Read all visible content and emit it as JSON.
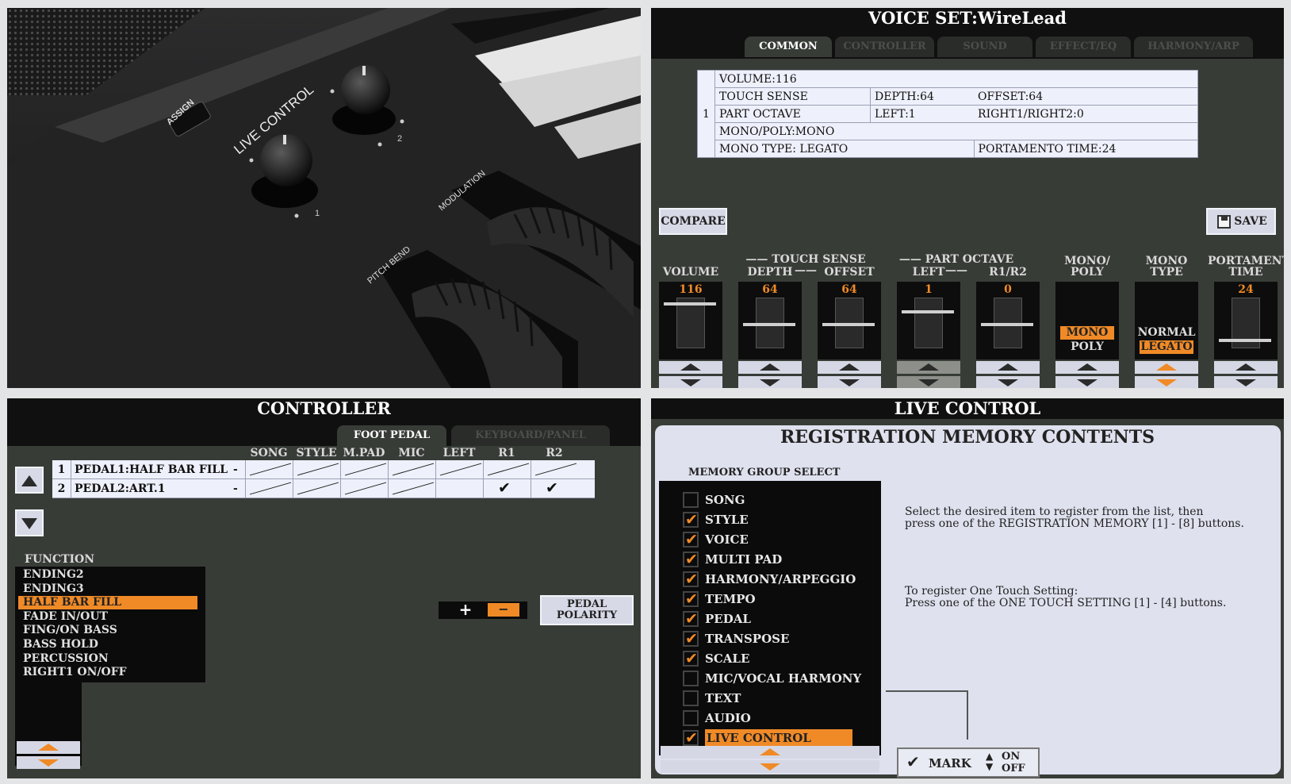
{
  "voice_set": {
    "title": "VOICE SET:WireLead",
    "tabs": [
      "COMMON",
      "CONTROLLER",
      "SOUND",
      "EFFECT/EQ",
      "HARMONY/ARP"
    ],
    "info_table": {
      "part_number": "1",
      "volume": "VOLUME:116",
      "touch_sense": "TOUCH SENSE",
      "depth": "DEPTH:64",
      "offset": "OFFSET:64",
      "part_octave": "PART OCTAVE",
      "left": "LEFT:1",
      "right": "RIGHT1/RIGHT2:0",
      "mono_poly": "MONO/POLY:MONO",
      "mono_type": "MONO TYPE: LEGATO",
      "portamento": "PORTAMENTO TIME:24"
    },
    "compare_label": "COMPARE",
    "save_label": "SAVE",
    "group_touch_sense": "TOUCH SENSE",
    "group_part_octave": "PART OCTAVE",
    "columns": [
      {
        "label": "VOLUME",
        "value": "116",
        "level": 0.91
      },
      {
        "label": "DEPTH",
        "value": "64",
        "level": 0.5
      },
      {
        "label": "OFFSET",
        "value": "64",
        "level": 0.5
      },
      {
        "label": "LEFT",
        "value": "1",
        "level": 0.75
      },
      {
        "label": "R1/R2",
        "value": "0",
        "level": 0.5
      },
      {
        "label": "MONO/\nPOLY",
        "options": [
          "MONO",
          "POLY"
        ],
        "selected": "MONO"
      },
      {
        "label": "MONO\nTYPE",
        "options": [
          "NORMAL",
          "LEGATO"
        ],
        "selected": "LEGATO"
      },
      {
        "label": "PORTAMENT\nTIME",
        "value": "24",
        "level": 0.19
      }
    ]
  },
  "controller": {
    "title": "CONTROLLER",
    "tabs": [
      "FOOT PEDAL",
      "KEYBOARD/PANEL"
    ],
    "col_headers": [
      "SONG",
      "STYLE",
      "M.PAD",
      "MIC",
      "LEFT",
      "R1",
      "R2"
    ],
    "rows": [
      {
        "num": "1",
        "name": "PEDAL1:HALF BAR FILL",
        "dash": "-",
        "checks": [
          false,
          false,
          false,
          false,
          false,
          false,
          false
        ]
      },
      {
        "num": "2",
        "name": "PEDAL2:ART.1",
        "dash": "-",
        "checks": [
          false,
          false,
          false,
          false,
          false,
          true,
          true
        ]
      }
    ],
    "function_label": "FUNCTION",
    "functions": [
      "ENDING2",
      "ENDING3",
      "HALF BAR FILL",
      "FADE IN/OUT",
      "FING/ON BASS",
      "BASS HOLD",
      "PERCUSSION",
      "RIGHT1 ON/OFF"
    ],
    "selected_function": "HALF BAR FILL",
    "plus": "+",
    "minus": "−",
    "pedal_polarity": "PEDAL\nPOLARITY"
  },
  "live_control": {
    "title": "LIVE CONTROL",
    "heading": "REGISTRATION MEMORY CONTENTS",
    "group_select_label": "MEMORY GROUP SELECT",
    "items": [
      {
        "label": "SONG",
        "checked": false
      },
      {
        "label": "STYLE",
        "checked": true
      },
      {
        "label": "VOICE",
        "checked": true
      },
      {
        "label": "MULTI PAD",
        "checked": true
      },
      {
        "label": "HARMONY/ARPEGGIO",
        "checked": true
      },
      {
        "label": "TEMPO",
        "checked": true
      },
      {
        "label": "PEDAL",
        "checked": true
      },
      {
        "label": "TRANSPOSE",
        "checked": true
      },
      {
        "label": "SCALE",
        "checked": true
      },
      {
        "label": "MIC/VOCAL HARMONY",
        "checked": false
      },
      {
        "label": "TEXT",
        "checked": false
      },
      {
        "label": "AUDIO",
        "checked": false
      },
      {
        "label": "LIVE CONTROL",
        "checked": true,
        "selected": true
      }
    ],
    "help1": "Select the desired item to register from the list, then\npress one of the REGISTRATION MEMORY [1] - [8] buttons.",
    "help2": "To register One Touch Setting:\nPress one of the ONE TOUCH SETTING [1] - [4] buttons.",
    "mark_label": "MARK",
    "on_label": "ON",
    "off_label": "OFF"
  },
  "photo": {
    "assign": "ASSIGN",
    "live_control": "LIVE CONTROL",
    "knob1": "1",
    "knob2": "2",
    "modulation": "MODULATION",
    "pitch_bend": "PITCH BEND"
  }
}
